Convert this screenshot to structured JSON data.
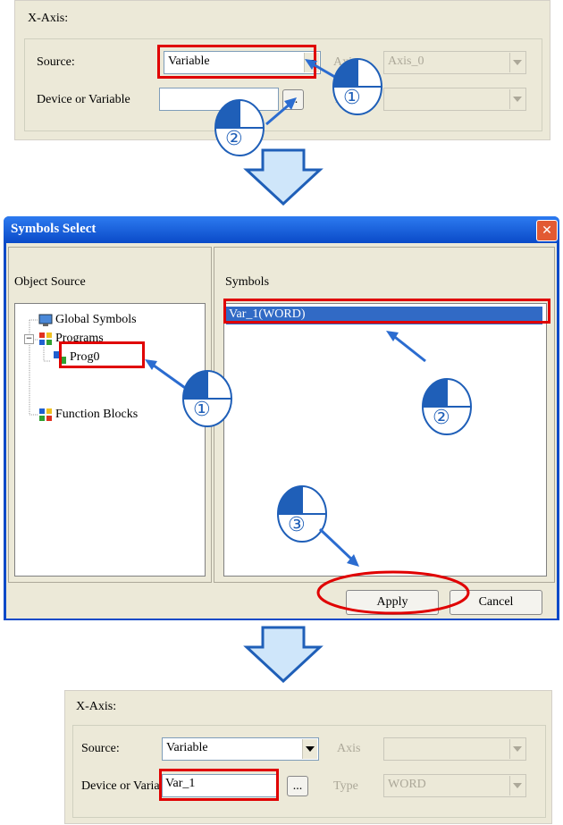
{
  "panel_top": {
    "title": "X-Axis:",
    "source_label": "Source:",
    "source_value": "Variable",
    "axis_label": "Axis",
    "axis_value": "Axis_0",
    "device_label": "Device or Variable",
    "device_value": "",
    "browse_label": "...",
    "type_label": "Type",
    "type_value": ""
  },
  "dialog": {
    "title": "Symbols Select",
    "close_label": "✕",
    "object_source_label": "Object Source",
    "symbols_label": "Symbols",
    "tree": {
      "global_symbols": "Global Symbols",
      "programs": "Programs",
      "prog0": "Prog0",
      "function_blocks": "Function Blocks",
      "expand_sign": "−"
    },
    "symbols": [
      "Var_1(WORD)"
    ],
    "apply_label": "Apply",
    "cancel_label": "Cancel"
  },
  "panel_bottom": {
    "title": "X-Axis:",
    "source_label": "Source:",
    "source_value": "Variable",
    "axis_label": "Axis",
    "axis_value": "",
    "device_label": "Device or Variable",
    "device_value": "Var_1",
    "browse_label": "...",
    "type_label": "Type",
    "type_value": "WORD"
  },
  "steps": {
    "one": "①",
    "two": "②",
    "three": "③"
  },
  "colors": {
    "highlight_red": "#e00000",
    "arrow_blue": "#2b6cd0",
    "titlebar_blue": "#0a4ac8",
    "selection_blue": "#316ac5",
    "big_arrow_fill": "#cfe6fa"
  }
}
